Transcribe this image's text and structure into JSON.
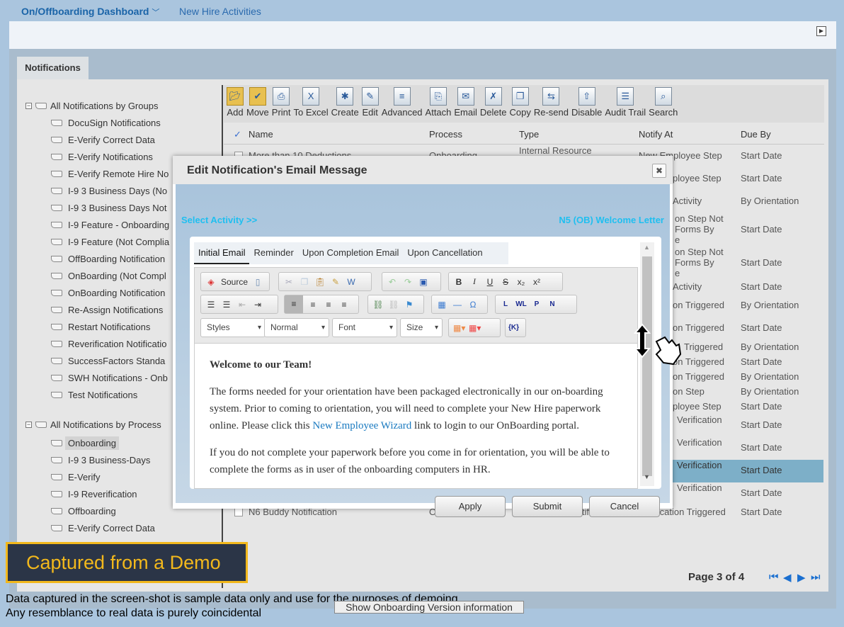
{
  "topnav": {
    "dashboard": "On/Offboarding Dashboard",
    "chevron": "chevron-down-icon",
    "new_hire": "New Hire Activities"
  },
  "tab": "Notifications",
  "tree": {
    "groups_header": "All Notifications by Groups",
    "groups": [
      "DocuSign Notifications",
      "E-Verify Correct Data",
      "E-Verify Notifications",
      "E-Verify Remote Hire No",
      "I-9 3 Business Days (No",
      "I-9 3 Business Days Not",
      "I-9 Feature - Onboarding",
      "I-9 Feature (Not Complia",
      "OffBoarding Notification",
      "OnBoarding (Not Compl",
      "OnBoarding Notification",
      "Re-Assign Notifications",
      "Restart Notifications",
      "Reverification Notificatio",
      "SuccessFactors Standa",
      "SWH Notifications - Onb",
      "Test Notifications"
    ],
    "process_header": "All Notifications by Process",
    "processes": [
      "Onboarding",
      "I-9 3 Business-Days",
      "E-Verify",
      "I-9 Reverification",
      "Offboarding",
      "E-Verify Correct Data"
    ],
    "selected": "Onboarding"
  },
  "toolbar": [
    "Add",
    "Move",
    "Print",
    "To Excel",
    "Create",
    "Edit",
    "Advanced",
    "Attach",
    "Email",
    "Delete",
    "Copy",
    "Re-send",
    "Disable",
    "Audit Trail",
    "Search"
  ],
  "table": {
    "headers": {
      "name": "Name",
      "process": "Process",
      "type": "Type",
      "notify": "Notify At",
      "due": "Due By"
    },
    "rows": [
      {
        "name": "More than 10 Deductions",
        "process": "Onboarding",
        "type": "Internal Resource",
        "notify": "New Employee Step",
        "due": "Start Date"
      },
      {
        "notify": "ployee Step",
        "due": "Start Date"
      },
      {
        "notify": "Activity",
        "due": "By Orientation"
      },
      {
        "notify": "on Step Not\nForms By\ne",
        "due": "Start Date"
      },
      {
        "notify": "on Step Not\nForms By\ne",
        "due": "Start Date"
      },
      {
        "notify": "Activity",
        "due": "Start Date"
      },
      {
        "notify": "on Triggered",
        "due": "By Orientation"
      },
      {
        "notify": "on Triggered",
        "due": "Start Date"
      },
      {
        "notify": "Triggered",
        "due": "By Orientation"
      },
      {
        "notify": "on Triggered",
        "due": "Start Date"
      },
      {
        "notify": "on Triggered",
        "due": "By Orientation"
      },
      {
        "notify": "on Step",
        "due": "By Orientation"
      },
      {
        "notify": "ployee Step",
        "due": "Start Date"
      },
      {
        "notify": "Verification",
        "due": "Start Date"
      },
      {
        "notify": "Verification",
        "due": "Start Date"
      },
      {
        "notify": "Verification",
        "due": "Start Date",
        "selected": true
      },
      {
        "notify": "Verification",
        "due": "Start Date"
      },
      {
        "name": "N6 Buddy Notification",
        "process": "Onboarding",
        "type": "Data Driven Notification",
        "notify": "Notification Triggered",
        "due": "Start Date"
      }
    ],
    "selected_color": "#7dafc8"
  },
  "modal": {
    "title": "Edit Notification's Email Message",
    "select_activity": "Select Activity >>",
    "activity_name": "N5 (OB) Welcome Letter",
    "tabs": [
      "Initial Email",
      "Reminder",
      "Upon Completion Email",
      "Upon Cancellation"
    ],
    "editor": {
      "source": "Source",
      "styles": "Styles",
      "format": "Normal",
      "font": "Font",
      "size": "Size",
      "field": "{K}",
      "link_buttons": [
        "L",
        "WL",
        "P",
        "N"
      ]
    },
    "content": {
      "heading": "Welcome to our Team!",
      "p1_before": "The forms needed for your orientation have been packaged electronically in our on-boarding system. Prior to coming to orientation, you will need to complete your New Hire paperwork online. Please click  this ",
      "p1_link": "New Employee Wizard",
      "p1_after": " link to login to our OnBoarding portal.",
      "p2": "If you do not complete your paperwork before you come in for orientation, you will be able to complete the forms as in user of the onboarding computers in HR."
    },
    "buttons": {
      "apply": "Apply",
      "submit": "Submit",
      "cancel": "Cancel"
    }
  },
  "pager": {
    "label": "Page 3 of 4",
    "current": 3,
    "total": 4
  },
  "demo_banner": "Captured from a Demo",
  "disclaimer": [
    "Data captured in the screen-shot is sample data only and use for the purposes of demoing.",
    "Any resemblance to real data is purely coincidental"
  ],
  "version_button": "Show Onboarding Version information",
  "colors": {
    "accent": "#1a64a8",
    "banner_bg": "#2b3547",
    "banner_text": "#f2b81c",
    "activity_link": "#1fbff0"
  }
}
